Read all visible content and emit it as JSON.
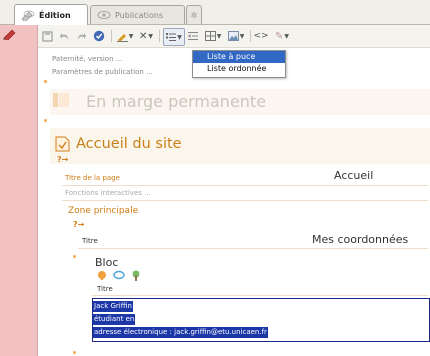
{
  "tabs": {
    "edition": "Édition",
    "publications": "Publications"
  },
  "toolbar": {
    "icons": [
      "save-icon",
      "undo-icon",
      "redo-icon",
      "check-icon",
      "pen-icon",
      "remove-format-icon",
      "list-icon",
      "outdent-icon",
      "table-icon",
      "image-icon",
      "source-code-icon",
      "spell-check-icon"
    ]
  },
  "list_menu": {
    "items": [
      "Liste à puce",
      "Liste ordonnée"
    ],
    "highlighted_index": 0
  },
  "page": {
    "paternite": "Paternité, version ...",
    "parametres": "Paramètres de publication ...",
    "marge_title": "En marge permanente",
    "marge_dots": "...",
    "site_title": "Accueil du site",
    "arrow": "?→",
    "titre_page_label": "Titre de la page",
    "titre_page_value": "Accueil",
    "fonctions": "Fonctions interactives ...",
    "zone_principale": "Zone principale",
    "titre_label": "Titre",
    "titre_value": "Mes coordonnées",
    "bloc": "Bloc",
    "bloc_titre_label": "Titre",
    "selected_lines": [
      "Jack Griffin",
      "étudiant en",
      "adresse électronique : jack.griffin@etu.unicaen.fr"
    ]
  },
  "colors": {
    "accent_orange": "#d07b16",
    "gutter_pink": "#f2c1c1",
    "selection_blue": "#1c37a8",
    "menu_highlight": "#3168c4"
  }
}
